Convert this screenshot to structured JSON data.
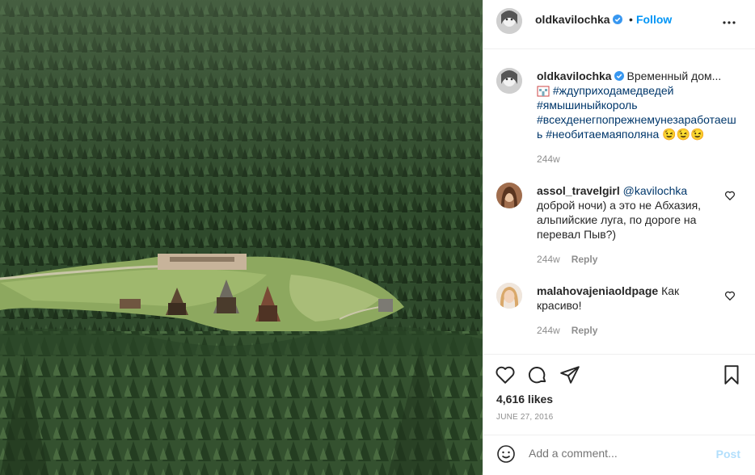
{
  "post": {
    "author": "oldkavilochka",
    "follow_label": "Follow",
    "separator": "•"
  },
  "caption": {
    "author": "oldkavilochka",
    "text": "Временный дом...",
    "hashtags": [
      "#ждуприходамедведей",
      "#ямышиныйкороль",
      "#всехденегпопрежнемунезаработаешь",
      "#необитаемаяполяна"
    ],
    "emojis": "😉😉😉",
    "time": "244w"
  },
  "comments": [
    {
      "author": "assol_travelgirl",
      "mention": "@kavilochka",
      "text": "доброй ночи) а это не Абхазия, альпийские луга, по дороге на перевал Пыв?)",
      "time": "244w",
      "reply_label": "Reply"
    },
    {
      "author": "malahovajeniaoldpage",
      "text": "Как красиво!",
      "time": "244w",
      "reply_label": "Reply"
    }
  ],
  "stats": {
    "likes": "4,616 likes",
    "date": "JUNE 27, 2016"
  },
  "composer": {
    "placeholder": "Add a comment...",
    "post_label": "Post"
  },
  "icons": {
    "verified": "verified-badge-icon",
    "more": "more-options-icon",
    "like": "heart-icon",
    "comment": "comment-bubble-icon",
    "share": "paper-plane-icon",
    "save": "bookmark-icon",
    "emoji": "emoji-smile-icon"
  },
  "colors": {
    "accent": "#0095f6",
    "hashtag": "#00376b",
    "muted": "#8e8e8e"
  }
}
